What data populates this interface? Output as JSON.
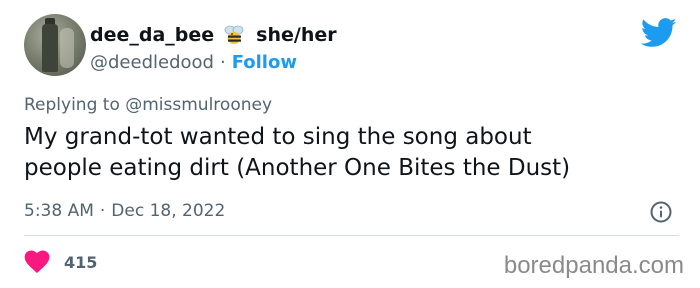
{
  "user": {
    "display_name": "dee_da_bee",
    "pronouns": "she/her",
    "handle": "@deedledood",
    "separator": "·",
    "follow_label": "Follow"
  },
  "reply": {
    "prefix": "Replying to",
    "mention": "@missmulrooney"
  },
  "tweet": {
    "lines": [
      "My grand-tot wanted to sing the song about",
      "people eating dirt (Another One Bites the Dust)"
    ]
  },
  "meta": {
    "time": "5:38 AM",
    "separator": "·",
    "date": "Dec 18, 2022"
  },
  "stats": {
    "likes": "415"
  },
  "watermark": "boredpanda.com",
  "icons": {
    "bee": "bee-emoji-icon",
    "bird": "twitter-bird-icon",
    "info": "info-icon",
    "heart": "heart-icon"
  },
  "colors": {
    "accent": "#1d9bf0",
    "heart": "#f91880",
    "muted": "#536471",
    "text": "#0f1419"
  }
}
